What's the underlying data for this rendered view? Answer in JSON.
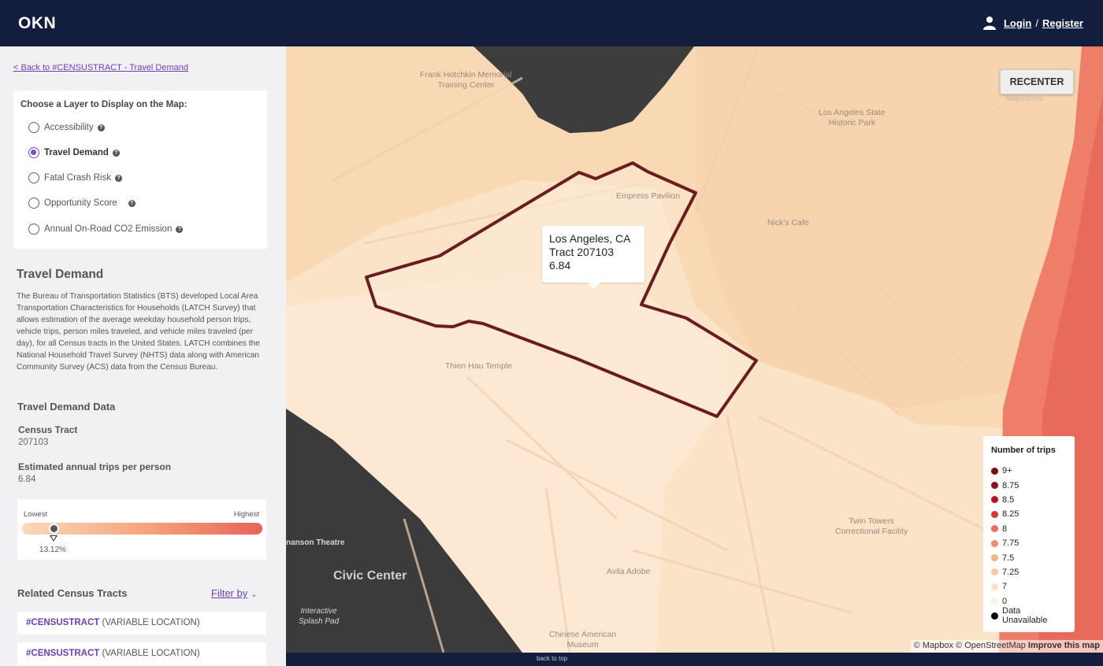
{
  "header": {
    "brand": "OKN",
    "login": "Login",
    "separator": "/",
    "register": "Register"
  },
  "sidebar": {
    "back_link": "< Back to #CENSUSTRACT - Travel Demand",
    "layer_title": "Choose a Layer to Display on the Map:",
    "layers": [
      {
        "label": "Accessibility",
        "selected": false
      },
      {
        "label": "Travel Demand",
        "selected": true
      },
      {
        "label": "Fatal Crash Risk",
        "selected": false
      },
      {
        "label": "Opportunity Score",
        "selected": false
      },
      {
        "label": "Annual On-Road CO2 Emission",
        "selected": false
      }
    ],
    "section_title": "Travel Demand",
    "description": "The Bureau of Transportation Statistics (BTS) developed Local Area Transportation Characteristics for Households (LATCH Survey) that allows estimation of the average weekday household person trips, vehicle trips, person miles traveled, and vehicle miles traveled (per day), for all Census tracts in the United States. LATCH combines the National Household Travel Survey (NHTS) data along with American Community Survey (ACS) data from the Census Bureau.",
    "data_title": "Travel Demand Data",
    "census_tract_label": "Census Tract",
    "census_tract_value": "207103",
    "trips_label": "Estimated annual trips per person",
    "trips_value": "6.84",
    "scale": {
      "low": "Lowest",
      "high": "Highest",
      "percentile": "13.12%",
      "position": 0.1312
    },
    "related_title": "Related Census Tracts",
    "filter_label": "Filter by",
    "related": [
      {
        "tag": "#CENSUSTRACT",
        "location": "(VARIABLE LOCATION)"
      },
      {
        "tag": "#CENSUSTRACT",
        "location": "(VARIABLE LOCATION)"
      }
    ]
  },
  "map": {
    "recenter": "RECENTER",
    "popup": {
      "line1": "Los Angeles, CA",
      "line2": "Tract 207103",
      "line3": "6.84"
    },
    "labels": {
      "frank": "Frank Hotchkin Memorial\nTraining Center",
      "la_state": "Los Angeles State\nHistoric Park",
      "empress": "Empress Pavilion",
      "nicks": "Nick's Cafe",
      "thien": "Thien Hau Temple",
      "twin": "Twin Towers\nCorrectional Facility",
      "avila": "Avila Adobe",
      "chinese": "Chinese American\nMuseum",
      "civic": "Civic Center",
      "splash": "Interactive\nSplash Pad",
      "theatre": "nanson Theatre",
      "majordomo": "Majordomo"
    },
    "legend": {
      "title": "Number of trips",
      "items": [
        {
          "label": "9+",
          "color": "#7a0f14"
        },
        {
          "label": "8.75",
          "color": "#8e1219"
        },
        {
          "label": "8.5",
          "color": "#b4161f"
        },
        {
          "label": "8.25",
          "color": "#d23a32"
        },
        {
          "label": "8",
          "color": "#ef6b5a"
        },
        {
          "label": "7.75",
          "color": "#f48a67"
        },
        {
          "label": "7.5",
          "color": "#f7b17f"
        },
        {
          "label": "7.25",
          "color": "#f9cb9a"
        },
        {
          "label": "7",
          "color": "#fbe2c4"
        },
        {
          "label": "0",
          "color": "#fdf1e4"
        },
        {
          "label": "Data Unavailable",
          "color": "#000000"
        }
      ]
    },
    "attribution": "© Mapbox © OpenStreetMap",
    "improve": "Improve this map"
  },
  "footer": {
    "back_to_top": "back to top"
  }
}
